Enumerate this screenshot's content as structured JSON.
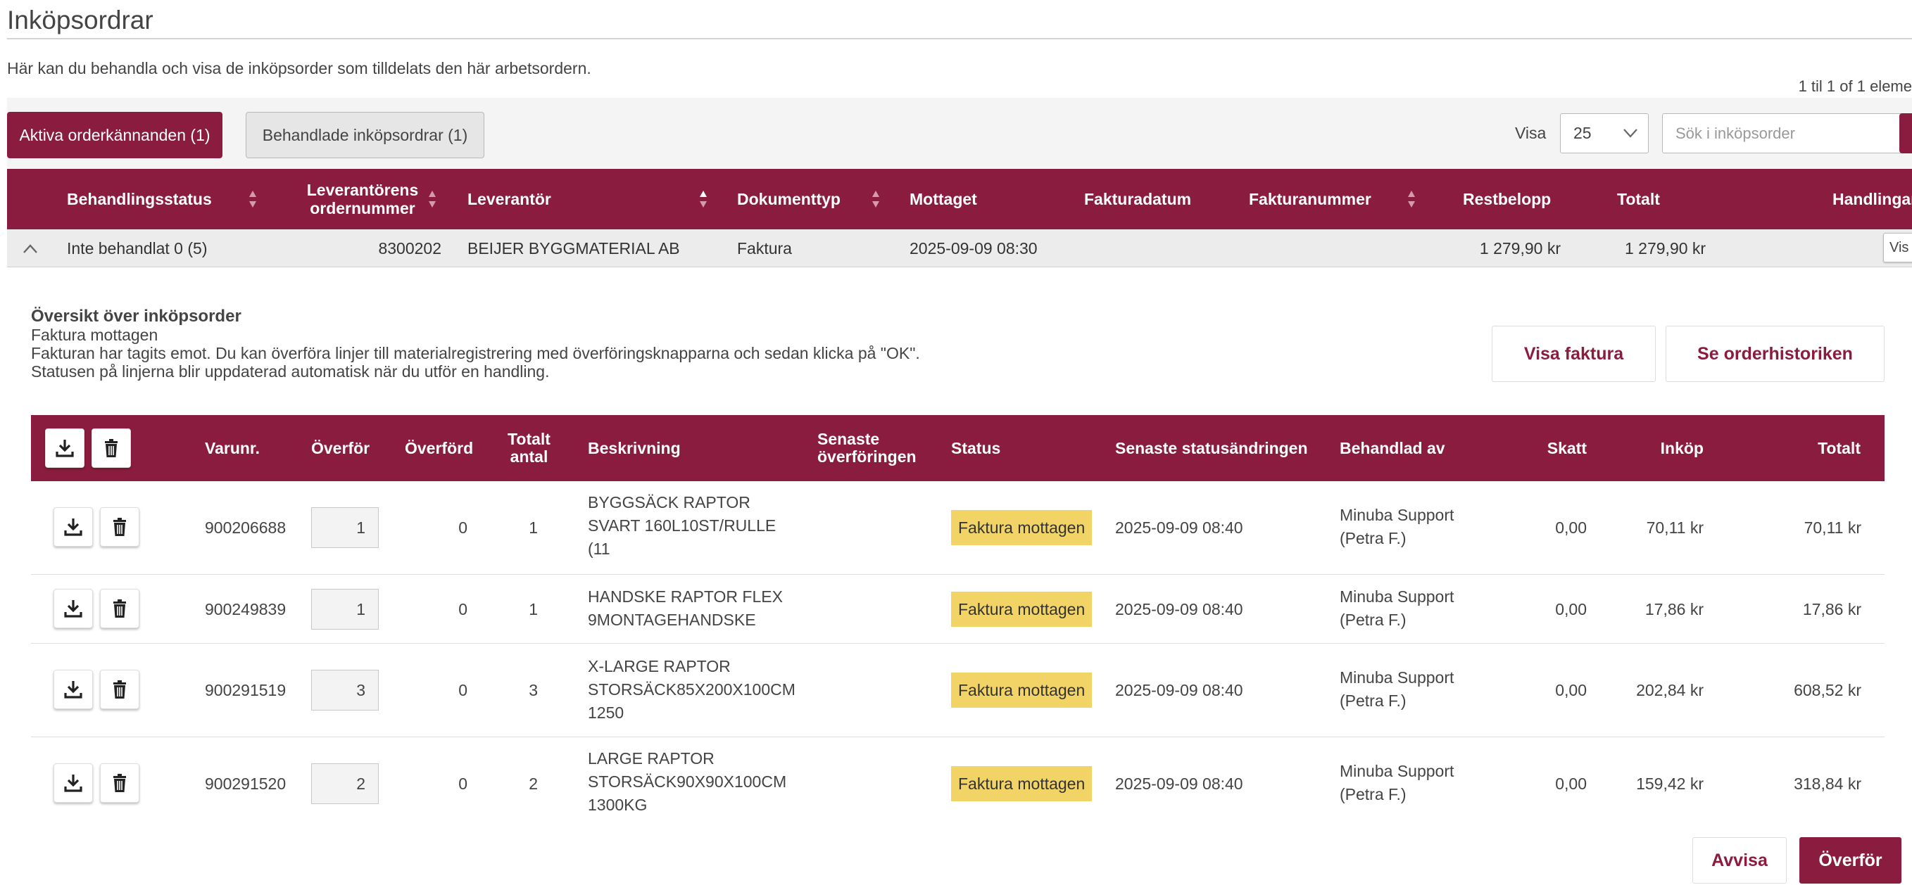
{
  "page": {
    "title": "Inköpsordrar",
    "intro": "Här kan du behandla och visa de inköpsorder som tilldelats den här arbetsordern.",
    "pagination": "1 til 1 of 1 eleme"
  },
  "toolbar": {
    "tab_active": "Aktiva orderkännanden (1)",
    "tab_processed": "Behandlade inköpsordrar (1)",
    "visa_label": "Visa",
    "page_size": "25",
    "search_placeholder": "Sök i inköpsorder"
  },
  "grid": {
    "headers": {
      "status": "Behandlingsstatus",
      "supplier_order_1": "Leverantörens",
      "supplier_order_2": "ordernummer",
      "supplier": "Leverantör",
      "doctype": "Dokumenttyp",
      "received": "Mottaget",
      "invoice_date": "Fakturadatum",
      "invoice_number": "Fakturanummer",
      "remaining": "Restbelopp",
      "total": "Totalt",
      "actions": "Handlingar"
    },
    "row": {
      "status": "Inte behandlat 0 (5)",
      "order_number": "8300202",
      "supplier": "BEIJER BYGGMATERIAL AB",
      "doctype": "Faktura",
      "received": "2025-09-09 08:30",
      "invoice_date": "",
      "invoice_number": "",
      "remaining": "1 279,90 kr",
      "total": "1 279,90 kr",
      "action_label": "Vis"
    }
  },
  "overview": {
    "title": "Översikt över inköpsorder",
    "status_line": "Faktura mottagen",
    "line1": "Fakturan har tagits emot. Du kan överföra linjer till materialregistrering med överföringsknapparna och sedan klicka på \"OK\".",
    "line2": "Statusen på linjerna blir uppdaterad automatisk när du utför en handling.",
    "btn_invoice": "Visa faktura",
    "btn_history": "Se orderhistoriken"
  },
  "lines": {
    "headers": {
      "item_no": "Varunr.",
      "transfer": "Överför",
      "transferred": "Överförd",
      "total_qty_1": "Totalt",
      "total_qty_2": "antal",
      "description": "Beskrivning",
      "latest_transfer_1": "Senaste",
      "latest_transfer_2": "överföringen",
      "status": "Status",
      "latest_status_change": "Senaste statusändringen",
      "handled_by": "Behandlad av",
      "tax": "Skatt",
      "purchase": "Inköp",
      "total": "Totalt"
    },
    "rows": [
      {
        "item_no": "900206688",
        "transfer": "1",
        "transferred": "0",
        "total_qty": "1",
        "desc": [
          "BYGGSÄCK RAPTOR",
          "SVART 160L10ST/RULLE",
          "(11"
        ],
        "status": "Faktura mottagen",
        "changed": "2025-09-09 08:40",
        "by": [
          "Minuba Support",
          "(Petra F.)"
        ],
        "tax": "0,00",
        "purchase": "70,11 kr",
        "total": "70,11 kr"
      },
      {
        "item_no": "900249839",
        "transfer": "1",
        "transferred": "0",
        "total_qty": "1",
        "desc": [
          "HANDSKE RAPTOR FLEX",
          "9MONTAGEHANDSKE"
        ],
        "status": "Faktura mottagen",
        "changed": "2025-09-09 08:40",
        "by": [
          "Minuba Support",
          "(Petra F.)"
        ],
        "tax": "0,00",
        "purchase": "17,86 kr",
        "total": "17,86 kr"
      },
      {
        "item_no": "900291519",
        "transfer": "3",
        "transferred": "0",
        "total_qty": "3",
        "desc": [
          "X-LARGE RAPTOR",
          "STORSÄCK85X200X100CM",
          "1250"
        ],
        "status": "Faktura mottagen",
        "changed": "2025-09-09 08:40",
        "by": [
          "Minuba Support",
          "(Petra F.)"
        ],
        "tax": "0,00",
        "purchase": "202,84 kr",
        "total": "608,52 kr"
      },
      {
        "item_no": "900291520",
        "transfer": "2",
        "transferred": "0",
        "total_qty": "2",
        "desc": [
          "LARGE RAPTOR",
          "STORSÄCK90X90X100CM",
          "1300KG"
        ],
        "status": "Faktura mottagen",
        "changed": "2025-09-09 08:40",
        "by": [
          "Minuba Support",
          "(Petra F.)"
        ],
        "tax": "0,00",
        "purchase": "159,42 kr",
        "total": "318,84 kr"
      }
    ]
  },
  "footer": {
    "reject": "Avvisa",
    "transfer": "Överför"
  },
  "colors": {
    "brand": "#8a1c3f",
    "status_badge": "#f2d365"
  }
}
